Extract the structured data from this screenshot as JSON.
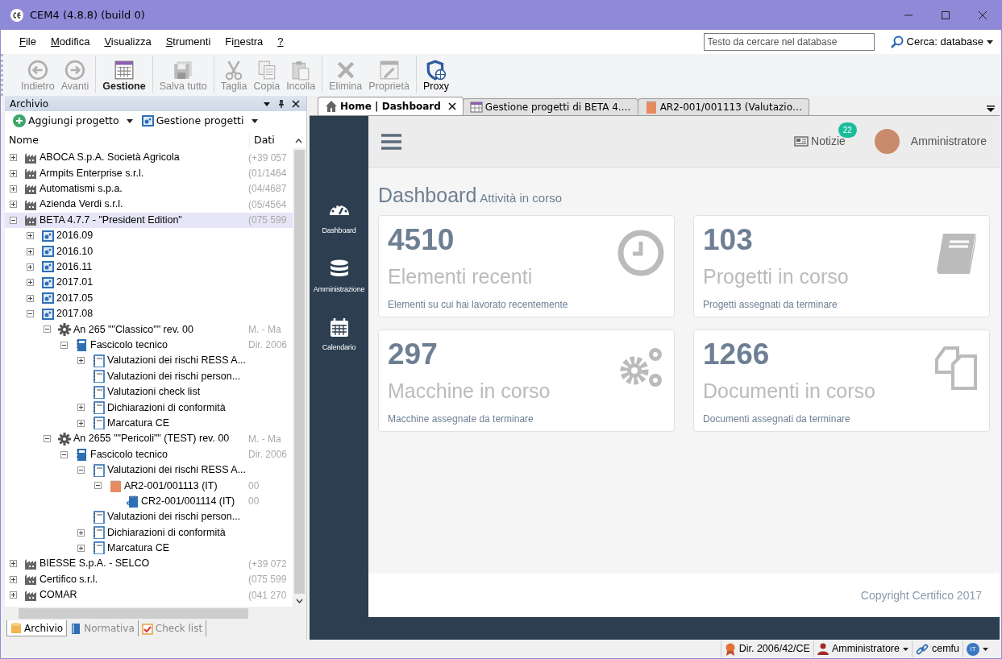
{
  "window": {
    "title": "CEM4 (4.8.8) (build 0)"
  },
  "menu": [
    {
      "access_key": "F",
      "after": "ile"
    },
    {
      "access_key": "M",
      "after": "odifica"
    },
    {
      "access_key": "V",
      "after": "isualizza"
    },
    {
      "access_key": "S",
      "after": "trumenti"
    },
    {
      "before": "Fi",
      "access_key": "n",
      "after": "estra"
    },
    {
      "access_key": "?"
    }
  ],
  "search": {
    "placeholder": "Testo da cercare nel database",
    "scope": "Cerca: database"
  },
  "toolbar": [
    [
      {
        "label": "Indietro",
        "kind": "back",
        "disabled": true,
        "selected": false
      },
      {
        "label": "Avanti",
        "kind": "forward",
        "disabled": true,
        "selected": false
      }
    ],
    [
      {
        "label": "Gestione",
        "kind": "calendar",
        "disabled": false,
        "selected": true
      }
    ],
    [
      {
        "label": "Salva tutto",
        "kind": "save",
        "disabled": true,
        "selected": false
      }
    ],
    [
      {
        "label": "Taglia",
        "kind": "cut",
        "disabled": true,
        "selected": false
      },
      {
        "label": "Copia",
        "kind": "copy",
        "disabled": true,
        "selected": false
      },
      {
        "label": "Incolla",
        "kind": "paste",
        "disabled": true,
        "selected": false
      }
    ],
    [
      {
        "label": "Elimina",
        "kind": "delete",
        "disabled": true,
        "selected": false
      },
      {
        "label": "Proprietà",
        "kind": "properties",
        "disabled": true,
        "selected": false
      }
    ],
    [
      {
        "label": "Proxy",
        "kind": "shield",
        "disabled": false,
        "selected": false
      }
    ]
  ],
  "archive_panel": {
    "title": "Archivio",
    "actions": [
      {
        "label": "Aggiungi progetto",
        "kind": "add"
      },
      {
        "label": "Gestione progetti",
        "kind": "manage"
      }
    ],
    "columns": [
      "Nome",
      "Dati"
    ],
    "tree": [
      {
        "label": "ABOCA S.p.A. Società Agricola",
        "data": "(+39 057",
        "kind": "company",
        "expanded": false,
        "selected": false
      },
      {
        "label": "Armpits Enterprise s.r.l.",
        "data": "(01/1464",
        "kind": "company",
        "expanded": false,
        "selected": false
      },
      {
        "label": "Automatismi s.p.a.",
        "data": "(04/4687",
        "kind": "company",
        "expanded": false,
        "selected": false
      },
      {
        "label": "Azienda Verdi s.r.l.",
        "data": "(05/4564",
        "kind": "company",
        "expanded": false,
        "selected": false
      },
      {
        "label": "BETA 4.7.7 - \"President Edition\"",
        "data": "(075 599",
        "kind": "company",
        "expanded": true,
        "selected": true,
        "children": [
          {
            "label": "2016.09",
            "kind": "folder",
            "expanded": false,
            "selected": false
          },
          {
            "label": "2016.10",
            "kind": "folder",
            "expanded": false,
            "selected": false
          },
          {
            "label": "2016.11",
            "kind": "folder",
            "expanded": false,
            "selected": false
          },
          {
            "label": "2017.01",
            "kind": "folder",
            "expanded": false,
            "selected": false
          },
          {
            "label": "2017.05",
            "kind": "folder",
            "expanded": false,
            "selected": false
          },
          {
            "label": "2017.08",
            "kind": "folder",
            "expanded": true,
            "selected": false,
            "children": [
              {
                "label": "An 265 \"\"Classico\"\" rev. 00",
                "data": "M. - Ma",
                "kind": "machine",
                "expanded": true,
                "selected": false,
                "children": [
                  {
                    "label": "Fascicolo tecnico",
                    "data": "Dir. 2006",
                    "kind": "binder",
                    "expanded": true,
                    "selected": false,
                    "children": [
                      {
                        "label": "Valutazioni dei rischi RESS A...",
                        "kind": "document",
                        "expanded": false,
                        "selected": false
                      },
                      {
                        "label": "Valutazioni dei rischi person...",
                        "kind": "document",
                        "selected": false
                      },
                      {
                        "label": "Valutazioni check list",
                        "kind": "document",
                        "selected": false
                      },
                      {
                        "label": "Dichiarazioni di conformità",
                        "kind": "document",
                        "expanded": false,
                        "selected": false
                      },
                      {
                        "label": "Marcatura CE",
                        "kind": "document",
                        "expanded": false,
                        "selected": false
                      }
                    ]
                  }
                ]
              },
              {
                "label": "An 2655 \"\"Pericoli\"\" (TEST) rev. 00",
                "data": "M. - Ma",
                "kind": "machine",
                "expanded": true,
                "selected": false,
                "children": [
                  {
                    "label": "Fascicolo tecnico",
                    "data": "Dir. 2006",
                    "kind": "binder",
                    "expanded": true,
                    "selected": false,
                    "children": [
                      {
                        "label": "Valutazioni dei rischi RESS A...",
                        "kind": "document",
                        "expanded": true,
                        "selected": false,
                        "children": [
                          {
                            "label": "AR2-001/001113 (IT)",
                            "data": "00",
                            "kind": "report",
                            "expanded": true,
                            "selected": false,
                            "children": [
                              {
                                "label": "CR2-001/001114 (IT)",
                                "data": "00",
                                "kind": "sheet",
                                "selected": false
                              }
                            ]
                          }
                        ]
                      },
                      {
                        "label": "Valutazioni dei rischi person...",
                        "kind": "document",
                        "selected": false
                      },
                      {
                        "label": "Dichiarazioni di conformità",
                        "kind": "document",
                        "expanded": false,
                        "selected": false
                      },
                      {
                        "label": "Marcatura CE",
                        "kind": "document",
                        "expanded": false,
                        "selected": false
                      }
                    ]
                  }
                ]
              }
            ]
          }
        ]
      },
      {
        "label": "BIESSE S.p.A. - SELCO",
        "data": "(+39 072",
        "kind": "company",
        "expanded": false,
        "selected": false
      },
      {
        "label": "Certifico s.r.l.",
        "data": "(075 599",
        "kind": "company",
        "expanded": false,
        "selected": false
      },
      {
        "label": "COMAR",
        "data": "(041 270",
        "kind": "company",
        "expanded": false,
        "selected": false
      }
    ],
    "tabs": [
      {
        "label": "Archivio",
        "kind": "archive",
        "selected": true
      },
      {
        "label": "Normativa",
        "kind": "book",
        "selected": false
      },
      {
        "label": "Check list",
        "kind": "checklist",
        "selected": false
      }
    ]
  },
  "document_tabs": [
    {
      "label": "Home | Dashboard",
      "kind": "home",
      "selected": true
    },
    {
      "label": "Gestione progetti di BETA 4.…",
      "kind": "grid",
      "selected": false
    },
    {
      "label": "AR2-001/001113 (Valutazio…",
      "kind": "report",
      "selected": false
    }
  ],
  "dashboard": {
    "nav": [
      {
        "label": "Dashboard",
        "kind": "gauge"
      },
      {
        "label": "Amministrazione",
        "kind": "database"
      },
      {
        "label": "Calendario",
        "kind": "calendar"
      }
    ],
    "news": {
      "label": "Notizie",
      "count": "22"
    },
    "user": "Amministratore",
    "title": "Dashboard",
    "subtitle": "Attività in corso",
    "cards": [
      {
        "value": "4510",
        "title": "Elementi recenti",
        "description": "Elementi su cui hai lavorato recentemente",
        "kind": "clock"
      },
      {
        "value": "103",
        "title": "Progetti in corso",
        "description": "Progetti assegnati da terminare",
        "kind": "book"
      },
      {
        "value": "297",
        "title": "Macchine in corso",
        "description": "Macchine assegnate da terminare",
        "kind": "gears"
      },
      {
        "value": "1266",
        "title": "Documenti in corso",
        "description": "Documenti assegnati da terminare",
        "kind": "files"
      }
    ],
    "footer": "Copyright Certifico 2017"
  },
  "status_bar": {
    "directive": "Dir. 2006/42/CE",
    "user": "Amministratore",
    "connection": "cemfu",
    "language": "IT"
  }
}
